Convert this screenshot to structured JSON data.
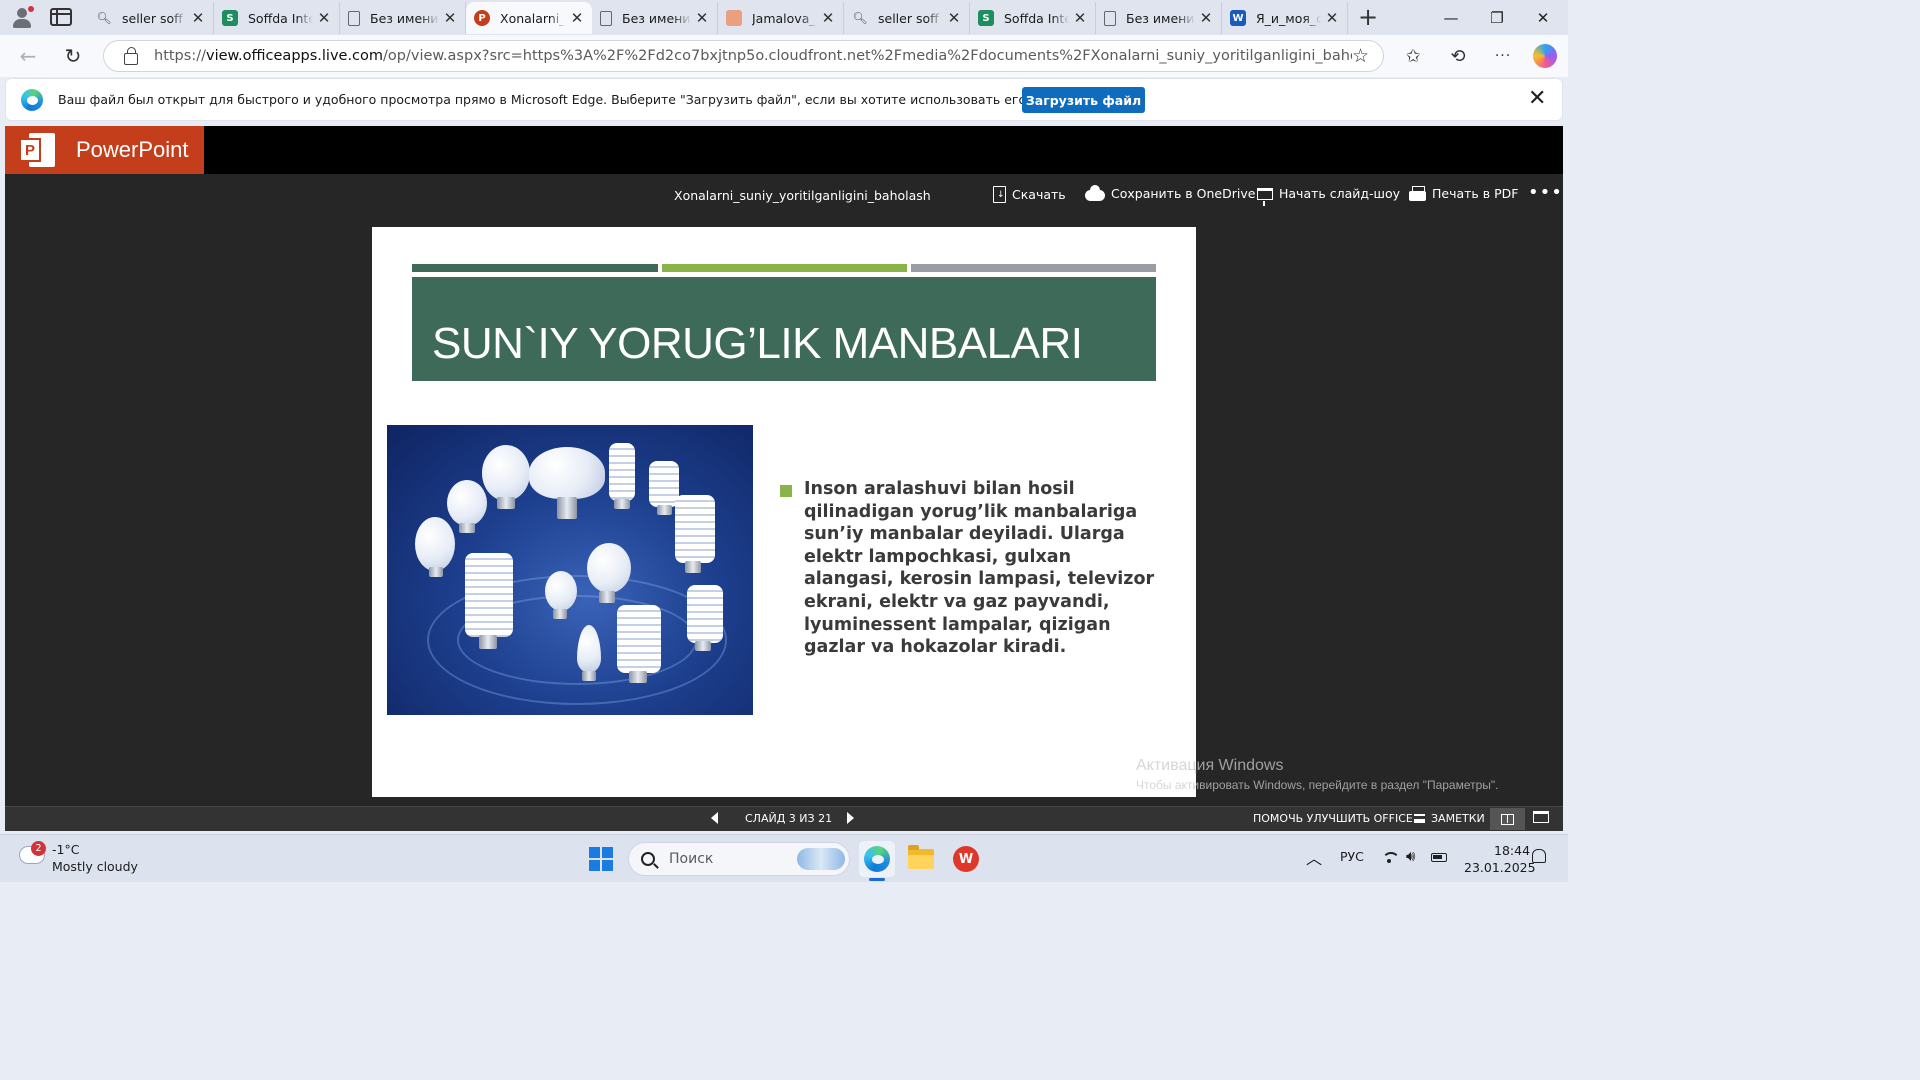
{
  "browser": {
    "tabs": [
      {
        "label": "seller soff uz",
        "icon": "search-icon",
        "active": false
      },
      {
        "label": "Soffda Intell",
        "icon": "soffda-icon",
        "active": false
      },
      {
        "label": "Без имени",
        "icon": "document-icon",
        "active": false
      },
      {
        "label": "Xonalarni_suniy",
        "icon": "powerpoint-icon",
        "active": true
      },
      {
        "label": "Без имени",
        "icon": "document-icon",
        "active": false
      },
      {
        "label": "Jamalova_Sh",
        "icon": "presentation-image-icon",
        "active": false
      },
      {
        "label": "seller soff uz",
        "icon": "search-icon",
        "active": false
      },
      {
        "label": "Soffda Intell",
        "icon": "soffda-icon",
        "active": false
      },
      {
        "label": "Без имени",
        "icon": "document-icon",
        "active": false
      },
      {
        "label": "Я_и_моя_семья",
        "icon": "word-icon",
        "active": false
      }
    ],
    "url_prefix": "https://",
    "url_host": "view.officeapps.live.com",
    "url_rest": "/op/view.aspx?src=https%3A%2F%2Fd2co7bxjtnp5o.cloudfront.net%2Fmedia%2Fdocuments%2FXonalarni_suniy_yoritilganligini_baholash.pptx&wdOrigin..."
  },
  "infobar": {
    "message": "Ваш файл был открыт для быстрого и удобного просмотра прямо в Microsoft Edge. Выберите \"Загрузить файл\", если вы хотите использовать его позже.",
    "button": "Загрузить файл"
  },
  "viewer": {
    "app_name": "PowerPoint",
    "doc_title": "Xonalarni_suniy_yoritilganligini_baholash",
    "actions": {
      "download": "Скачать",
      "save_onedrive": "Сохранить в OneDrive",
      "slideshow": "Начать слайд-шоу",
      "print_pdf": "Печать в PDF"
    },
    "status": {
      "slide_counter": "СЛАЙД 3 ИЗ 21",
      "help": "ПОМОЧЬ УЛУЧШИТЬ OFFICE",
      "notes": "ЗАМЕТКИ"
    }
  },
  "slide": {
    "title": "SUN`IY YORUG’LIK MANBALARI",
    "body": "Inson aralashuvi bilan hosil qilinadigan yorug’lik manbalariga sun’iy manbalar deyiladi. Ularga elektr lampochkasi, gulxan alangasi, kerosin lampasi, televizor ekrani, elektr va gaz payvandi, lyuminessent lampalar, qizigan gazlar va hokazolar kiradi.",
    "colors": {
      "title_bg": "#3e6a5a",
      "bar1": "#3e6a5a",
      "bar2": "#8ab44a",
      "bar3": "#9a9ea4",
      "bullet": "#8ab44a"
    }
  },
  "watermark": {
    "line1": "Активация Windows",
    "line2": "Чтобы активировать Windows, перейдите в раздел \"Параметры\"."
  },
  "taskbar": {
    "weather_badge": "2",
    "weather_temp": "-1°C",
    "weather_desc": "Mostly cloudy",
    "search_placeholder": "Поиск",
    "language": "РУС",
    "time": "18:44",
    "date": "23.01.2025"
  }
}
